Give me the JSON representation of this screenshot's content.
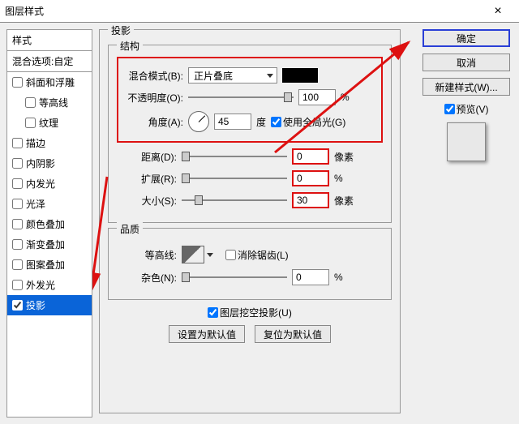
{
  "window": {
    "title": "图层样式"
  },
  "sidebar": {
    "header": "样式",
    "blend_header": "混合选项:自定",
    "items": [
      {
        "label": "斜面和浮雕",
        "checked": false
      },
      {
        "label": "等高线",
        "checked": false,
        "child": true
      },
      {
        "label": "纹理",
        "checked": false,
        "child": true
      },
      {
        "label": "描边",
        "checked": false
      },
      {
        "label": "内阴影",
        "checked": false
      },
      {
        "label": "内发光",
        "checked": false
      },
      {
        "label": "光泽",
        "checked": false
      },
      {
        "label": "颜色叠加",
        "checked": false
      },
      {
        "label": "渐变叠加",
        "checked": false
      },
      {
        "label": "图案叠加",
        "checked": false
      },
      {
        "label": "外发光",
        "checked": false
      },
      {
        "label": "投影",
        "checked": true,
        "selected": true
      }
    ]
  },
  "panel": {
    "title": "投影",
    "structure": {
      "title": "结构",
      "blend_mode_label": "混合模式(B):",
      "blend_mode_value": "正片叠底",
      "opacity_label": "不透明度(O):",
      "opacity_value": "100",
      "opacity_unit": "%",
      "angle_label": "角度(A):",
      "angle_value": "45",
      "angle_unit": "度",
      "global_light_label": "使用全局光(G)",
      "distance_label": "距离(D):",
      "distance_value": "0",
      "distance_unit": "像素",
      "spread_label": "扩展(R):",
      "spread_value": "0",
      "spread_unit": "%",
      "size_label": "大小(S):",
      "size_value": "30",
      "size_unit": "像素"
    },
    "quality": {
      "title": "品质",
      "contour_label": "等高线:",
      "antialias_label": "消除锯齿(L)",
      "noise_label": "杂色(N):",
      "noise_value": "0",
      "noise_unit": "%"
    },
    "knockout_label": "图层挖空投影(U)",
    "set_default_label": "设置为默认值",
    "reset_default_label": "复位为默认值"
  },
  "buttons": {
    "ok": "确定",
    "cancel": "取消",
    "new_style": "新建样式(W)...",
    "preview": "预览(V)"
  }
}
